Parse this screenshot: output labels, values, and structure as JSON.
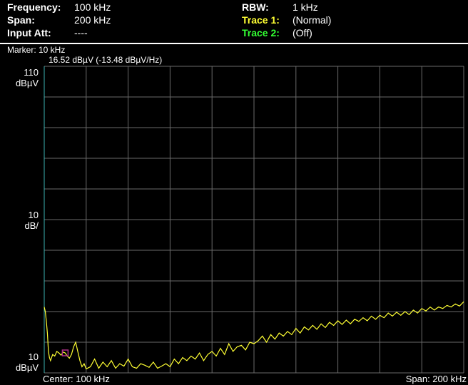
{
  "header": {
    "frequency_label": "Frequency:",
    "frequency_value": "100 kHz",
    "span_label": "Span:",
    "span_value": "200 kHz",
    "input_att_label": "Input Att:",
    "input_att_value": "----",
    "rbw_label": "RBW:",
    "rbw_value": "1 kHz",
    "trace1_label": "Trace 1:",
    "trace1_value": "(Normal)",
    "trace1_color": "#ffff33",
    "trace2_label": "Trace 2:",
    "trace2_value": "(Off)",
    "trace2_color": "#33ff33"
  },
  "marker": {
    "line1": "Marker: 10 kHz",
    "line2": "16.52 dBµV (-13.48 dBµV/Hz)"
  },
  "y_axis": {
    "top_value": "110",
    "top_unit": "dBµV",
    "scale_value": "10",
    "scale_unit": "dB/",
    "bottom_value": "10",
    "bottom_unit": "dBµV"
  },
  "footer": {
    "center": "Center: 100 kHz",
    "span": "Span: 200 kHz"
  },
  "colors": {
    "grid": "#6a6a6a",
    "trace": "#ffff33",
    "marker": "#b0308a",
    "start_line": "#3ab0b0"
  },
  "chart_data": {
    "type": "line",
    "xlabel": "",
    "ylabel": "",
    "x_unit": "kHz",
    "y_unit": "dBµV",
    "xlim": [
      0,
      200
    ],
    "ylim": [
      10,
      110
    ],
    "grid": true,
    "marker": {
      "x": 10,
      "y": 16.52
    },
    "series": [
      {
        "x": [
          0,
          0.5,
          1,
          1.5,
          2,
          2.5,
          3,
          4,
          5,
          6,
          7,
          8,
          9,
          10,
          11,
          12,
          13,
          14,
          15,
          16,
          17,
          18,
          19,
          20,
          22,
          24,
          26,
          28,
          30,
          32,
          34,
          36,
          38,
          40,
          42,
          44,
          46,
          48,
          50,
          52,
          54,
          56,
          58,
          60,
          62,
          64,
          66,
          68,
          70,
          72,
          74,
          76,
          78,
          80,
          82,
          84,
          86,
          88,
          90,
          92,
          94,
          96,
          98,
          100,
          102,
          104,
          106,
          108,
          110,
          112,
          114,
          116,
          118,
          120,
          122,
          124,
          126,
          128,
          130,
          132,
          134,
          136,
          138,
          140,
          142,
          144,
          146,
          148,
          150,
          152,
          154,
          156,
          158,
          160,
          162,
          164,
          166,
          168,
          170,
          172,
          174,
          176,
          178,
          180,
          182,
          184,
          186,
          188,
          190,
          192,
          194,
          196,
          198,
          200
        ],
        "values": [
          31.5,
          30,
          27,
          23,
          17,
          15,
          14,
          16,
          15.5,
          17,
          16.5,
          15.8,
          16.8,
          16.5,
          15.5,
          14.8,
          16,
          18.5,
          20,
          17,
          14,
          12,
          13,
          11.3,
          12,
          14.5,
          11.5,
          13.5,
          12,
          14,
          11.5,
          13,
          12.2,
          14.5,
          12,
          11.5,
          13,
          12.5,
          11.8,
          13.5,
          11.5,
          12.2,
          13,
          12,
          14.5,
          13,
          15,
          14,
          15.5,
          14.5,
          16.5,
          14,
          16,
          17,
          15.5,
          18,
          16,
          19.5,
          17,
          18.5,
          19,
          17.5,
          20,
          19.5,
          20.5,
          22,
          20,
          22.5,
          21,
          23,
          22,
          23.5,
          22.5,
          24.5,
          23,
          25,
          24,
          25.5,
          24.2,
          26,
          24.8,
          26.5,
          25.5,
          27,
          25.8,
          27.2,
          26,
          27.5,
          26.8,
          28,
          27,
          28.5,
          27.5,
          28.8,
          28,
          29.5,
          28.5,
          29.8,
          28.8,
          30,
          29,
          30.5,
          29.5,
          31,
          30.2,
          31.5,
          30.5,
          31.5,
          31,
          32,
          31.5,
          32.5,
          31.8,
          33.2
        ]
      }
    ]
  }
}
